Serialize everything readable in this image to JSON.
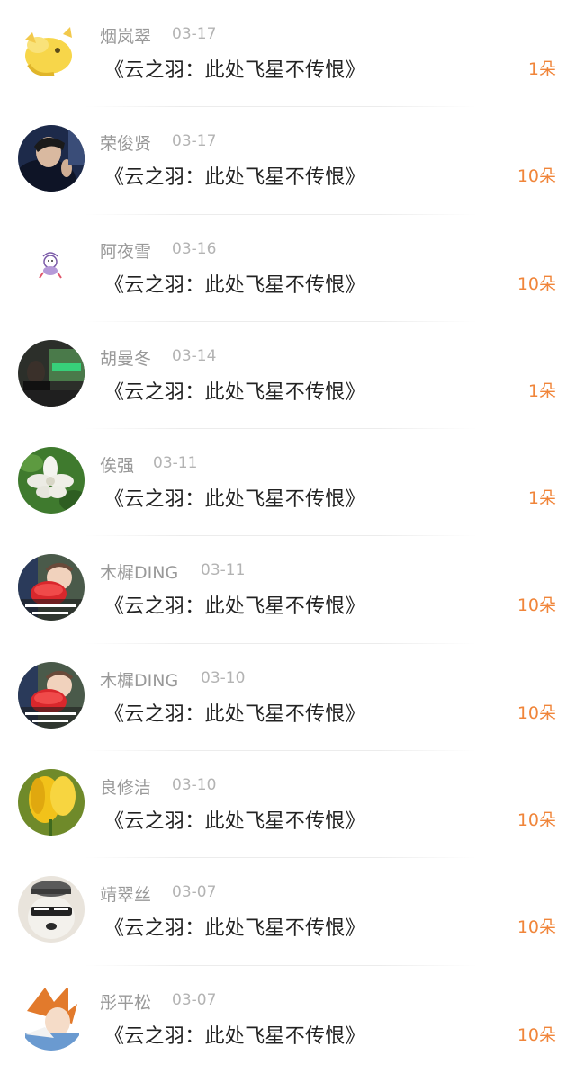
{
  "items": [
    {
      "name": "烟岚翠",
      "date": "03-17",
      "title": "《云之羽：此处飞星不传恨》",
      "count": "1朵",
      "avatar": "cartoon-pet-avatar-icon"
    },
    {
      "name": "荣俊贤",
      "date": "03-17",
      "title": "《云之羽：此处飞星不传恨》",
      "count": "10朵",
      "avatar": "man-portrait-avatar-icon"
    },
    {
      "name": "阿夜雪",
      "date": "03-16",
      "title": "《云之羽：此处飞星不传恨》",
      "count": "10朵",
      "avatar": "cartoon-sticker-avatar-icon"
    },
    {
      "name": "胡曼冬",
      "date": "03-14",
      "title": "《云之羽：此处飞星不传恨》",
      "count": "1朵",
      "avatar": "night-street-avatar-icon"
    },
    {
      "name": "俟强",
      "date": "03-11",
      "title": "《云之羽：此处飞星不传恨》",
      "count": "1朵",
      "avatar": "white-flower-avatar-icon"
    },
    {
      "name": "木樨DING",
      "date": "03-11",
      "title": "《云之羽：此处飞星不传恨》",
      "count": "10朵",
      "avatar": "baby-bowl-avatar-icon"
    },
    {
      "name": "木樨DING",
      "date": "03-10",
      "title": "《云之羽：此处飞星不传恨》",
      "count": "10朵",
      "avatar": "baby-bowl-avatar-icon"
    },
    {
      "name": "良修洁",
      "date": "03-10",
      "title": "《云之羽：此处飞星不传恨》",
      "count": "10朵",
      "avatar": "yellow-tulip-avatar-icon"
    },
    {
      "name": "靖翠丝",
      "date": "03-07",
      "title": "《云之羽：此处飞星不传恨》",
      "count": "10朵",
      "avatar": "dog-sunglasses-avatar-icon"
    },
    {
      "name": "彤平松",
      "date": "03-07",
      "title": "《云之羽：此处飞星不传恨》",
      "count": "10朵",
      "avatar": "anime-character-avatar-icon"
    }
  ]
}
